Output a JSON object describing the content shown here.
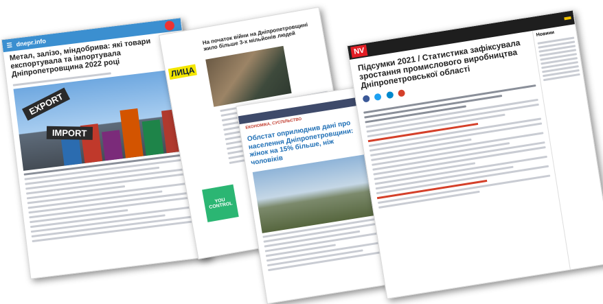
{
  "page1": {
    "site_logo": "dnepr.info",
    "headline": "Метал, залізо, міндобрива: які товари експортувала та імпортувала Дніпропетровщина 2022 році",
    "image_sign_top": "EXPORT",
    "image_sign_bottom": "IMPORT"
  },
  "page2": {
    "headline": "На початок війни на Дніпропетровщині жило більше 3-х мільйонів людей",
    "badge": "ЛИЦА",
    "ad_text": "YOU CONTROL"
  },
  "page3": {
    "category": "ЕКОНОМІКА, СУСПІЛЬСТВО",
    "headline": "Облстат оприлюднив дані про населення Дніпропетровщини: жінок на 15% більше, ніж чоловіків"
  },
  "page4": {
    "logo": "NV",
    "headline": "Підсумки 2021 / Статистика зафіксувала зростання промислового виробництва Дніпропетровської області",
    "sidebar_title": "Новини"
  },
  "colors": {
    "p1_header": "#3b8fd0",
    "nv_red": "#e21d24",
    "p3_nav": "#3e4a6a",
    "link_blue": "#1f6fb5"
  }
}
